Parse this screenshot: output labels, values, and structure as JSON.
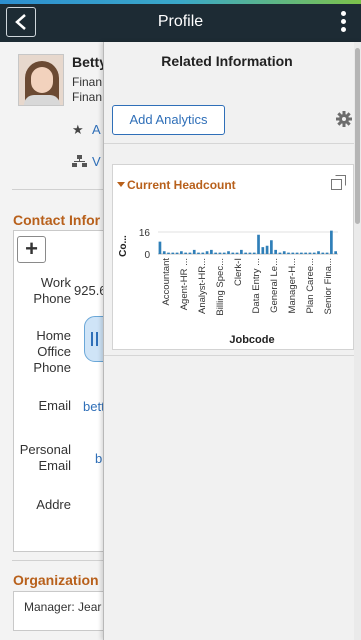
{
  "header": {
    "title": "Profile",
    "back_icon": "back-arrow-icon",
    "menu_icon": "kebab-menu-icon"
  },
  "profile": {
    "name": "Betty",
    "line1": "Finan",
    "line2": "Finan",
    "favorite_link": "A",
    "view_link": "V"
  },
  "contact": {
    "section_title": "Contact Infor",
    "add_icon": "plus-icon",
    "work_phone_label_1": "Work",
    "work_phone_label_2": "Phone",
    "work_phone_value": "925.6",
    "home_phone_label_1": "Home",
    "home_phone_label_2": "Office",
    "home_phone_label_3": "Phone",
    "email_label": "Email",
    "email_value": "bett",
    "personal_email_label_1": "Personal",
    "personal_email_label_2": "Email",
    "personal_email_value": "b",
    "address_label": "Addre"
  },
  "organization": {
    "section_title": "Organization",
    "manager": "Manager: Jear"
  },
  "related_panel": {
    "title": "Related Information",
    "add_button": "Add Analytics",
    "settings_icon": "gear-icon",
    "card_title": "Current Headcount",
    "expand_icon": "expand-icon",
    "accent_color": "#b8601b",
    "link_color": "#2f6fb8"
  },
  "chart_data": {
    "type": "bar",
    "title": "",
    "xlabel": "Jobcode",
    "ylabel": "Co...",
    "ylim": [
      0,
      16
    ],
    "yticks": [
      "16",
      "0"
    ],
    "tick_labels": [
      "Accountant",
      "Agent-HR ...",
      "Analyst-HR...",
      "Billing Spec...",
      "Clerk-I",
      "Data Entry ...",
      "General Le...",
      "Manager-H...",
      "Plan Caree...",
      "Senior Fina..."
    ],
    "values": [
      9,
      2,
      1,
      1,
      1,
      2,
      1,
      1,
      3,
      1,
      1,
      2,
      3,
      1,
      1,
      1,
      2,
      1,
      1,
      3,
      1,
      1,
      1,
      14,
      5,
      6,
      10,
      3,
      1,
      2,
      1,
      1,
      1,
      1,
      1,
      1,
      1,
      2,
      1,
      1,
      17,
      2
    ],
    "bar_color": "#2f7fb8"
  }
}
